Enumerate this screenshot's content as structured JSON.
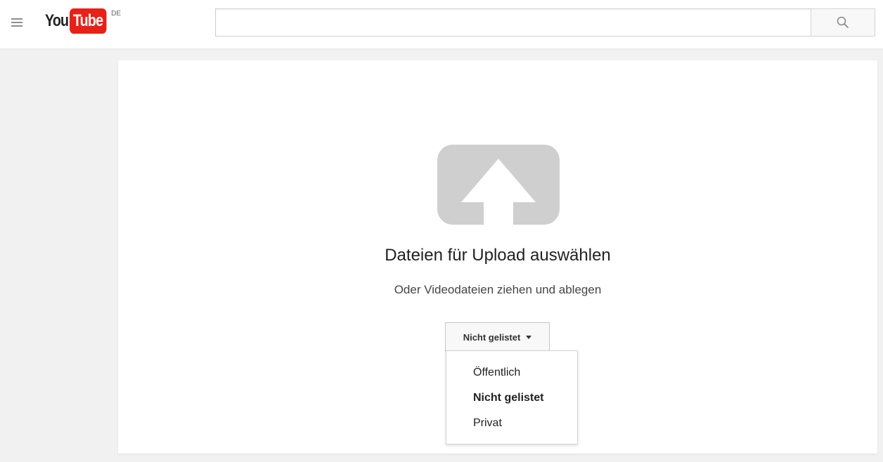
{
  "header": {
    "logo_you": "You",
    "logo_tube": "Tube",
    "country_code": "DE",
    "search": {
      "value": "",
      "placeholder": ""
    },
    "icons": {
      "menu": "hamburger-menu-icon",
      "search": "search-icon"
    }
  },
  "upload": {
    "icon": "upload-arrow-icon",
    "title": "Dateien für Upload auswählen",
    "subtitle": "Oder Videodateien ziehen und ablegen",
    "privacy": {
      "selected": "Nicht gelistet",
      "options": [
        {
          "label": "Öffentlich",
          "selected": false
        },
        {
          "label": "Nicht gelistet",
          "selected": true
        },
        {
          "label": "Privat",
          "selected": false
        }
      ]
    }
  },
  "colors": {
    "brand_red": "#e62117",
    "page_background": "#f1f1f1",
    "icon_gray": "#cfcfcf"
  }
}
